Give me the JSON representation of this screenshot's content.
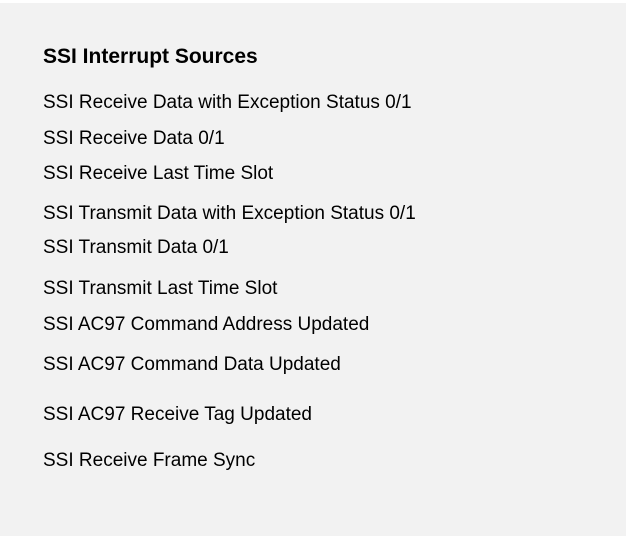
{
  "title": "SSI Interrupt Sources",
  "sources": [
    "SSI Receive Data with Exception Status 0/1",
    "SSI Receive Data 0/1",
    "SSI Receive Last Time Slot",
    "SSI Transmit Data with Exception Status 0/1",
    "SSI Transmit Data 0/1",
    "SSI Transmit Last Time Slot",
    "SSI AC97 Command Address Updated",
    "SSI AC97 Command Data Updated",
    "SSI AC97 Receive Tag Updated",
    "SSI Receive Frame Sync"
  ]
}
